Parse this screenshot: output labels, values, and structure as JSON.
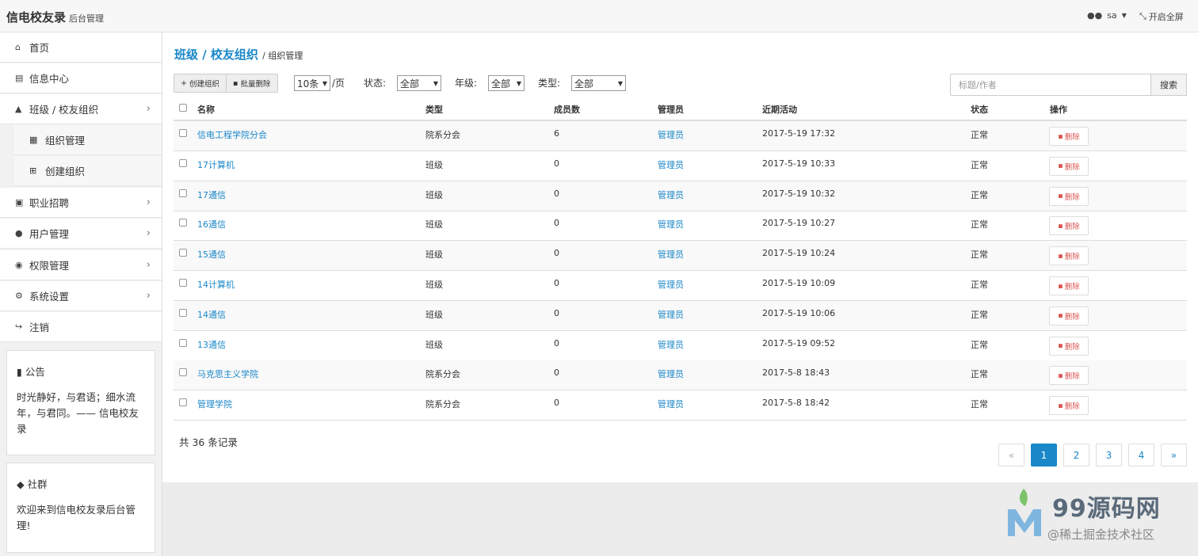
{
  "header": {
    "brand": "信电校友录",
    "brand_sub": "后台管理",
    "user": "sa",
    "fullscreen": "开启全屏"
  },
  "sidebar": {
    "items": [
      {
        "label": "首页",
        "icon": "home-icon"
      },
      {
        "label": "信息中心",
        "icon": "newspaper-icon"
      },
      {
        "label": "班级 / 校友组织",
        "icon": "graduation-cap-icon"
      },
      {
        "label": "职业招聘",
        "icon": "briefcase-icon"
      },
      {
        "label": "用户管理",
        "icon": "users-icon"
      },
      {
        "label": "权限管理",
        "icon": "eye-icon"
      },
      {
        "label": "系统设置",
        "icon": "cogs-icon"
      },
      {
        "label": "注销",
        "icon": "sign-out-icon"
      }
    ],
    "sub_items": [
      {
        "label": "组织管理",
        "icon": "bank-icon"
      },
      {
        "label": "创建组织",
        "icon": "plus-square-icon"
      }
    ],
    "notice": {
      "title": "公告",
      "body": "时光静好，与君语；细水流年，与君同。—— 信电校友录"
    },
    "community": {
      "title": "社群",
      "body": "欢迎来到信电校友录后台管理!"
    }
  },
  "breadcrumb": {
    "main": "班级 / 校友组织",
    "current": "组织管理"
  },
  "toolbar": {
    "create_label": "创建组织",
    "batch_delete_label": "批量删除",
    "page_size": "10条",
    "page_suffix": "/页",
    "status_label": "状态:",
    "status_value": "全部",
    "grade_label": "年级:",
    "grade_value": "全部",
    "type_label": "类型:",
    "type_value": "全部",
    "search_placeholder": "标题/作者",
    "search_button": "搜索"
  },
  "table": {
    "columns": [
      "名称",
      "类型",
      "成员数",
      "管理员",
      "近期活动",
      "状态",
      "操作"
    ],
    "rows": [
      {
        "name": "信电工程学院分会",
        "type": "院系分会",
        "members": "6",
        "admin": "管理员",
        "activity": "2017-5-19 17:32",
        "status": "正常",
        "action": "删除"
      },
      {
        "name": "17计算机",
        "type": "班级",
        "members": "0",
        "admin": "管理员",
        "activity": "2017-5-19 10:33",
        "status": "正常",
        "action": "删除"
      },
      {
        "name": "17通信",
        "type": "班级",
        "members": "0",
        "admin": "管理员",
        "activity": "2017-5-19 10:32",
        "status": "正常",
        "action": "删除"
      },
      {
        "name": "16通信",
        "type": "班级",
        "members": "0",
        "admin": "管理员",
        "activity": "2017-5-19 10:27",
        "status": "正常",
        "action": "删除"
      },
      {
        "name": "15通信",
        "type": "班级",
        "members": "0",
        "admin": "管理员",
        "activity": "2017-5-19 10:24",
        "status": "正常",
        "action": "删除"
      },
      {
        "name": "14计算机",
        "type": "班级",
        "members": "0",
        "admin": "管理员",
        "activity": "2017-5-19 10:09",
        "status": "正常",
        "action": "删除"
      },
      {
        "name": "14通信",
        "type": "班级",
        "members": "0",
        "admin": "管理员",
        "activity": "2017-5-19 10:06",
        "status": "正常",
        "action": "删除"
      },
      {
        "name": "13通信",
        "type": "班级",
        "members": "0",
        "admin": "管理员",
        "activity": "2017-5-19 09:52",
        "status": "正常",
        "action": "删除"
      },
      {
        "name": "马克思主义学院",
        "type": "院系分会",
        "members": "0",
        "admin": "管理员",
        "activity": "2017-5-8 18:43",
        "status": "正常",
        "action": "删除"
      },
      {
        "name": "管理学院",
        "type": "院系分会",
        "members": "0",
        "admin": "管理员",
        "activity": "2017-5-8 18:42",
        "status": "正常",
        "action": "删除"
      }
    ]
  },
  "footer": {
    "total": "共 36 条记录"
  },
  "pagination": {
    "prev": "«",
    "pages": [
      "1",
      "2",
      "3",
      "4"
    ],
    "next": "»",
    "active": "1"
  },
  "watermark": {
    "title": "99源码网",
    "sub": "@稀土掘金技术社区"
  },
  "colors": {
    "accent": "#1a87c8",
    "danger": "#d9534f"
  }
}
